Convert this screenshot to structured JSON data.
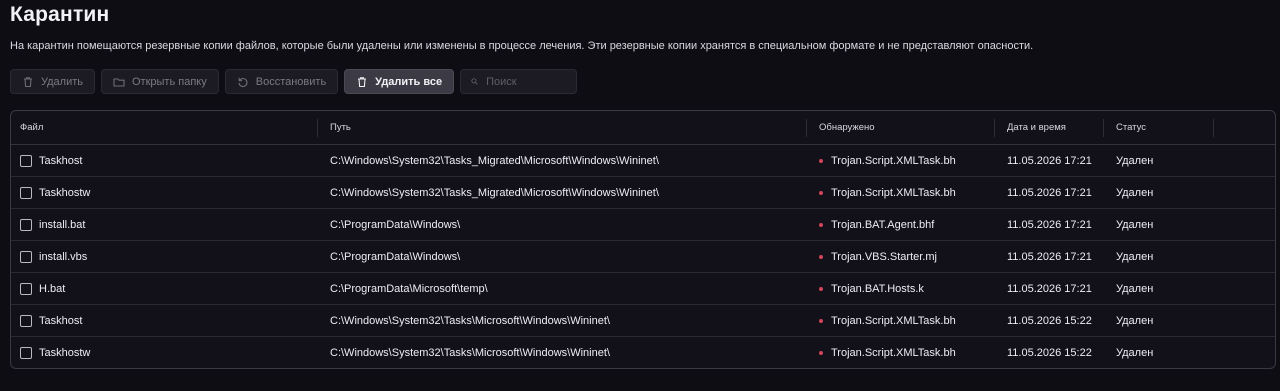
{
  "header": {
    "title": "Карантин",
    "description": "На карантин помещаются резервные копии файлов, которые были удалены или изменены в процессе лечения. Эти резервные копии хранятся в специальном формате и не представляют опасности."
  },
  "toolbar": {
    "delete_label": "Удалить",
    "open_folder_label": "Открыть папку",
    "restore_label": "Восстановить",
    "delete_all_label": "Удалить все",
    "search_placeholder": "Поиск",
    "search_value": ""
  },
  "table": {
    "columns": {
      "file": "Файл",
      "path": "Путь",
      "detected": "Обнаружено",
      "datetime": "Дата и время",
      "status": "Статус"
    },
    "rows": [
      {
        "file": "Taskhost",
        "path": "C:\\Windows\\System32\\Tasks_Migrated\\Microsoft\\Windows\\Wininet\\",
        "detected": "Trojan.Script.XMLTask.bh",
        "datetime": "11.05.2026 17:21",
        "status": "Удален"
      },
      {
        "file": "Taskhostw",
        "path": "C:\\Windows\\System32\\Tasks_Migrated\\Microsoft\\Windows\\Wininet\\",
        "detected": "Trojan.Script.XMLTask.bh",
        "datetime": "11.05.2026 17:21",
        "status": "Удален"
      },
      {
        "file": "install.bat",
        "path": "C:\\ProgramData\\Windows\\",
        "detected": "Trojan.BAT.Agent.bhf",
        "datetime": "11.05.2026 17:21",
        "status": "Удален"
      },
      {
        "file": "install.vbs",
        "path": "C:\\ProgramData\\Windows\\",
        "detected": "Trojan.VBS.Starter.mj",
        "datetime": "11.05.2026 17:21",
        "status": "Удален"
      },
      {
        "file": "H.bat",
        "path": "C:\\ProgramData\\Microsoft\\temp\\",
        "detected": "Trojan.BAT.Hosts.k",
        "datetime": "11.05.2026 17:21",
        "status": "Удален"
      },
      {
        "file": "Taskhost",
        "path": "C:\\Windows\\System32\\Tasks\\Microsoft\\Windows\\Wininet\\",
        "detected": "Trojan.Script.XMLTask.bh",
        "datetime": "11.05.2026 15:22",
        "status": "Удален"
      },
      {
        "file": "Taskhostw",
        "path": "C:\\Windows\\System32\\Tasks\\Microsoft\\Windows\\Wininet\\",
        "detected": "Trojan.Script.XMLTask.bh",
        "datetime": "11.05.2026 15:22",
        "status": "Удален"
      }
    ]
  },
  "icons": {
    "delete": "trash-icon",
    "open_folder": "folder-icon",
    "restore": "restore-icon",
    "delete_all": "trash-icon",
    "search": "search-icon",
    "threat": "threat-dot-icon"
  },
  "colors": {
    "background": "#0e0d14",
    "primary_button": "#3b3a45",
    "threat_dot": "#d0455a"
  }
}
